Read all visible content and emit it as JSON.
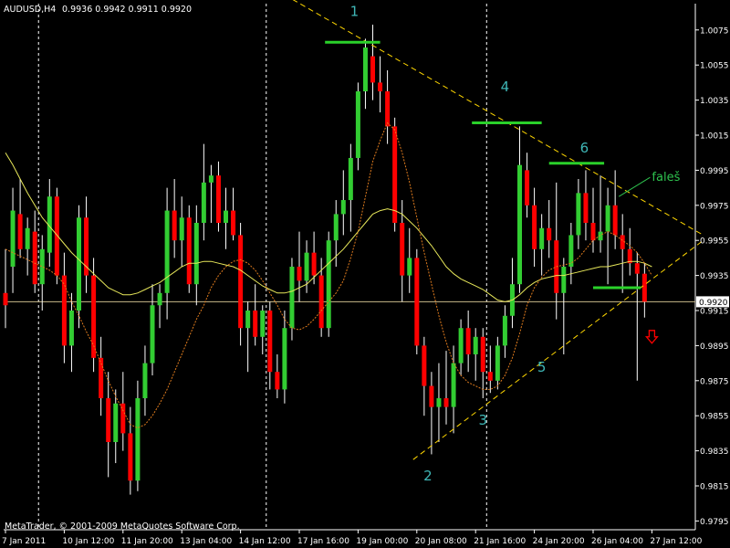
{
  "header": {
    "symbol": "AUDUSD,H4",
    "ohlc": "0.9936 0.9942 0.9911 0.9920"
  },
  "footer": {
    "copyright": "MetaTrader, © 2001-2009 MetaQuotes Software Corp."
  },
  "colors": {
    "background": "#000000",
    "bull_candle": "#32cd32",
    "bear_candle": "#ff0000",
    "wick": "#ffffff",
    "ma_slow": "#e8e85a",
    "ma_fast": "#e07c1e",
    "trendline": "#ffd700",
    "level_line": "#2ad12a",
    "wave_label": "#3fb7b7",
    "annotation": "#2ec24e",
    "arrow": "#ff0000",
    "price_line": "#c8b98a",
    "axis_text": "#ffffff"
  },
  "chart_data": {
    "type": "candlestick",
    "instrument": "AUDUSD",
    "timeframe": "H4",
    "ylim": [
      0.979,
      1.009
    ],
    "last_price": 0.992,
    "y_ticks": [
      "1.0075",
      "1.0055",
      "1.0035",
      "1.0015",
      "0.9995",
      "0.9975",
      "0.9955",
      "0.9935",
      "0.9915",
      "0.9895",
      "0.9875",
      "0.9855",
      "0.9835",
      "0.9815",
      "0.9795"
    ],
    "x_ticks": [
      "7 Jan 2011",
      "10 Jan 12:00",
      "11 Jan 20:00",
      "13 Jan 04:00",
      "14 Jan 12:00",
      "17 Jan 16:00",
      "19 Jan 00:00",
      "20 Jan 08:00",
      "21 Jan 16:00",
      "24 Jan 20:00",
      "26 Jan 04:00",
      "27 Jan 12:00"
    ],
    "x_tick_bars": [
      0,
      8,
      16,
      24,
      32,
      40,
      48,
      56,
      64,
      72,
      80,
      88
    ],
    "day_separators_bar": [
      4,
      35,
      65
    ],
    "candles": [
      {
        "o": 0.9925,
        "h": 0.995,
        "l": 0.9905,
        "c": 0.9918
      },
      {
        "o": 0.994,
        "h": 0.9985,
        "l": 0.9925,
        "c": 0.9972
      },
      {
        "o": 0.997,
        "h": 0.999,
        "l": 0.9945,
        "c": 0.995
      },
      {
        "o": 0.995,
        "h": 0.9968,
        "l": 0.9935,
        "c": 0.9962
      },
      {
        "o": 0.996,
        "h": 0.9972,
        "l": 0.9925,
        "c": 0.993
      },
      {
        "o": 0.993,
        "h": 0.9958,
        "l": 0.9915,
        "c": 0.995
      },
      {
        "o": 0.9948,
        "h": 0.999,
        "l": 0.994,
        "c": 0.998
      },
      {
        "o": 0.998,
        "h": 0.9985,
        "l": 0.993,
        "c": 0.9935
      },
      {
        "o": 0.9935,
        "h": 0.9948,
        "l": 0.9885,
        "c": 0.9895
      },
      {
        "o": 0.9895,
        "h": 0.9925,
        "l": 0.988,
        "c": 0.9915
      },
      {
        "o": 0.9915,
        "h": 0.9975,
        "l": 0.9905,
        "c": 0.9968
      },
      {
        "o": 0.9968,
        "h": 0.998,
        "l": 0.9925,
        "c": 0.9935
      },
      {
        "o": 0.9935,
        "h": 0.9945,
        "l": 0.988,
        "c": 0.9888
      },
      {
        "o": 0.9888,
        "h": 0.99,
        "l": 0.9855,
        "c": 0.9865
      },
      {
        "o": 0.9865,
        "h": 0.988,
        "l": 0.982,
        "c": 0.984
      },
      {
        "o": 0.984,
        "h": 0.987,
        "l": 0.9828,
        "c": 0.9862
      },
      {
        "o": 0.9862,
        "h": 0.988,
        "l": 0.9835,
        "c": 0.9845
      },
      {
        "o": 0.9845,
        "h": 0.986,
        "l": 0.981,
        "c": 0.9818
      },
      {
        "o": 0.9818,
        "h": 0.9875,
        "l": 0.9812,
        "c": 0.9865
      },
      {
        "o": 0.9865,
        "h": 0.9895,
        "l": 0.9855,
        "c": 0.9885
      },
      {
        "o": 0.9885,
        "h": 0.993,
        "l": 0.9878,
        "c": 0.9918
      },
      {
        "o": 0.9918,
        "h": 0.993,
        "l": 0.9905,
        "c": 0.9925
      },
      {
        "o": 0.9925,
        "h": 0.9985,
        "l": 0.991,
        "c": 0.9972
      },
      {
        "o": 0.9972,
        "h": 0.999,
        "l": 0.9945,
        "c": 0.9955
      },
      {
        "o": 0.9955,
        "h": 0.998,
        "l": 0.994,
        "c": 0.9968
      },
      {
        "o": 0.9968,
        "h": 0.9975,
        "l": 0.9925,
        "c": 0.993
      },
      {
        "o": 0.993,
        "h": 0.9975,
        "l": 0.9918,
        "c": 0.9965
      },
      {
        "o": 0.9965,
        "h": 1.001,
        "l": 0.9955,
        "c": 0.9988
      },
      {
        "o": 0.9988,
        "h": 0.9998,
        "l": 0.9965,
        "c": 0.9992
      },
      {
        "o": 0.9992,
        "h": 1.0,
        "l": 0.996,
        "c": 0.9965
      },
      {
        "o": 0.9965,
        "h": 0.9985,
        "l": 0.995,
        "c": 0.9972
      },
      {
        "o": 0.9972,
        "h": 0.9985,
        "l": 0.9955,
        "c": 0.9958
      },
      {
        "o": 0.9958,
        "h": 0.9965,
        "l": 0.9895,
        "c": 0.9905
      },
      {
        "o": 0.9905,
        "h": 0.992,
        "l": 0.988,
        "c": 0.9915
      },
      {
        "o": 0.9915,
        "h": 0.993,
        "l": 0.9895,
        "c": 0.99
      },
      {
        "o": 0.99,
        "h": 0.9918,
        "l": 0.989,
        "c": 0.9915
      },
      {
        "o": 0.9915,
        "h": 0.992,
        "l": 0.987,
        "c": 0.988
      },
      {
        "o": 0.988,
        "h": 0.989,
        "l": 0.9865,
        "c": 0.987
      },
      {
        "o": 0.987,
        "h": 0.9915,
        "l": 0.9862,
        "c": 0.9905
      },
      {
        "o": 0.9905,
        "h": 0.9945,
        "l": 0.9898,
        "c": 0.994
      },
      {
        "o": 0.994,
        "h": 0.996,
        "l": 0.992,
        "c": 0.9932
      },
      {
        "o": 0.9932,
        "h": 0.9955,
        "l": 0.9925,
        "c": 0.9948
      },
      {
        "o": 0.9948,
        "h": 0.996,
        "l": 0.993,
        "c": 0.9935
      },
      {
        "o": 0.9935,
        "h": 0.9945,
        "l": 0.99,
        "c": 0.9905
      },
      {
        "o": 0.9905,
        "h": 0.996,
        "l": 0.99,
        "c": 0.9955
      },
      {
        "o": 0.9955,
        "h": 0.9978,
        "l": 0.994,
        "c": 0.997
      },
      {
        "o": 0.997,
        "h": 0.9995,
        "l": 0.9958,
        "c": 0.9978
      },
      {
        "o": 0.9978,
        "h": 1.001,
        "l": 0.996,
        "c": 1.0002
      },
      {
        "o": 1.0002,
        "h": 1.0045,
        "l": 0.9995,
        "c": 1.004
      },
      {
        "o": 1.004,
        "h": 1.007,
        "l": 1.003,
        "c": 1.0065
      },
      {
        "o": 1.006,
        "h": 1.0078,
        "l": 1.0035,
        "c": 1.0045
      },
      {
        "o": 1.0045,
        "h": 1.006,
        "l": 1.0028,
        "c": 1.004
      },
      {
        "o": 1.004,
        "h": 1.0052,
        "l": 1.001,
        "c": 1.002
      },
      {
        "o": 1.002,
        "h": 1.0025,
        "l": 0.996,
        "c": 0.9965
      },
      {
        "o": 0.9965,
        "h": 0.9978,
        "l": 0.992,
        "c": 0.9935
      },
      {
        "o": 0.9935,
        "h": 0.9962,
        "l": 0.9925,
        "c": 0.9945
      },
      {
        "o": 0.9945,
        "h": 0.995,
        "l": 0.989,
        "c": 0.9895
      },
      {
        "o": 0.9895,
        "h": 0.99,
        "l": 0.9855,
        "c": 0.9872
      },
      {
        "o": 0.9872,
        "h": 0.988,
        "l": 0.9833,
        "c": 0.986
      },
      {
        "o": 0.986,
        "h": 0.9885,
        "l": 0.984,
        "c": 0.9865
      },
      {
        "o": 0.9865,
        "h": 0.9892,
        "l": 0.985,
        "c": 0.986
      },
      {
        "o": 0.986,
        "h": 0.9895,
        "l": 0.9845,
        "c": 0.9885
      },
      {
        "o": 0.9885,
        "h": 0.991,
        "l": 0.9878,
        "c": 0.9905
      },
      {
        "o": 0.9905,
        "h": 0.9915,
        "l": 0.988,
        "c": 0.989
      },
      {
        "o": 0.989,
        "h": 0.9905,
        "l": 0.9875,
        "c": 0.99
      },
      {
        "o": 0.99,
        "h": 0.9905,
        "l": 0.9865,
        "c": 0.988
      },
      {
        "o": 0.988,
        "h": 0.9895,
        "l": 0.9868,
        "c": 0.9875
      },
      {
        "o": 0.9875,
        "h": 0.99,
        "l": 0.987,
        "c": 0.9895
      },
      {
        "o": 0.9895,
        "h": 0.9918,
        "l": 0.9888,
        "c": 0.9912
      },
      {
        "o": 0.9912,
        "h": 0.9945,
        "l": 0.9905,
        "c": 0.993
      },
      {
        "o": 0.993,
        "h": 1.002,
        "l": 0.9925,
        "c": 0.9998
      },
      {
        "o": 0.9995,
        "h": 1.0005,
        "l": 0.9968,
        "c": 0.9975
      },
      {
        "o": 0.9975,
        "h": 0.9985,
        "l": 0.994,
        "c": 0.995
      },
      {
        "o": 0.995,
        "h": 0.997,
        "l": 0.9935,
        "c": 0.9962
      },
      {
        "o": 0.9962,
        "h": 0.9978,
        "l": 0.9945,
        "c": 0.9955
      },
      {
        "o": 0.9955,
        "h": 0.9988,
        "l": 0.991,
        "c": 0.9925
      },
      {
        "o": 0.9925,
        "h": 0.9945,
        "l": 0.989,
        "c": 0.994
      },
      {
        "o": 0.994,
        "h": 0.9965,
        "l": 0.993,
        "c": 0.9958
      },
      {
        "o": 0.9958,
        "h": 0.999,
        "l": 0.995,
        "c": 0.9982
      },
      {
        "o": 0.9982,
        "h": 0.9995,
        "l": 0.9955,
        "c": 0.9965
      },
      {
        "o": 0.9965,
        "h": 0.9985,
        "l": 0.9948,
        "c": 0.9955
      },
      {
        "o": 0.9955,
        "h": 0.9992,
        "l": 0.9948,
        "c": 0.996
      },
      {
        "o": 0.996,
        "h": 0.9985,
        "l": 0.993,
        "c": 0.9975
      },
      {
        "o": 0.9975,
        "h": 0.9995,
        "l": 0.995,
        "c": 0.9958
      },
      {
        "o": 0.9958,
        "h": 0.997,
        "l": 0.9925,
        "c": 0.995
      },
      {
        "o": 0.995,
        "h": 0.9962,
        "l": 0.9935,
        "c": 0.9942
      },
      {
        "o": 0.9942,
        "h": 0.9948,
        "l": 0.9875,
        "c": 0.9936
      },
      {
        "o": 0.9936,
        "h": 0.9942,
        "l": 0.9911,
        "c": 0.992
      }
    ],
    "ma_slow": [
      1.0005,
      0.9998,
      0.999,
      0.9982,
      0.9975,
      0.9968,
      0.9963,
      0.9958,
      0.9953,
      0.9948,
      0.9944,
      0.994,
      0.9936,
      0.9932,
      0.9928,
      0.9926,
      0.9924,
      0.9924,
      0.9925,
      0.9927,
      0.9929,
      0.9931,
      0.9934,
      0.9937,
      0.994,
      0.9942,
      0.9942,
      0.9943,
      0.9943,
      0.9942,
      0.9941,
      0.994,
      0.9938,
      0.9935,
      0.9932,
      0.9929,
      0.9927,
      0.9925,
      0.9925,
      0.9926,
      0.9928,
      0.993,
      0.9934,
      0.9938,
      0.9942,
      0.9946,
      0.995,
      0.9955,
      0.996,
      0.9965,
      0.997,
      0.9972,
      0.9973,
      0.9972,
      0.997,
      0.9966,
      0.9962,
      0.9957,
      0.9952,
      0.9946,
      0.994,
      0.9936,
      0.9933,
      0.9931,
      0.9929,
      0.9927,
      0.9924,
      0.9921,
      0.992,
      0.9921,
      0.9924,
      0.9928,
      0.9931,
      0.9933,
      0.9934,
      0.9935,
      0.9935,
      0.9936,
      0.9937,
      0.9938,
      0.9939,
      0.994,
      0.994,
      0.9941,
      0.9942,
      0.9943,
      0.9943,
      0.9942,
      0.994
    ],
    "ma_fast": [
      0.995,
      0.9948,
      0.9946,
      0.9944,
      0.9942,
      0.994,
      0.9938,
      0.9935,
      0.993,
      0.992,
      0.9912,
      0.9903,
      0.9895,
      0.9885,
      0.9875,
      0.9866,
      0.9858,
      0.985,
      0.9848,
      0.985,
      0.9855,
      0.9862,
      0.987,
      0.988,
      0.989,
      0.99,
      0.991,
      0.9918,
      0.9928,
      0.9935,
      0.994,
      0.9943,
      0.9944,
      0.9942,
      0.9938,
      0.9932,
      0.9925,
      0.9918,
      0.991,
      0.9905,
      0.9904,
      0.9906,
      0.991,
      0.9915,
      0.992,
      0.9925,
      0.9932,
      0.9945,
      0.996,
      0.998,
      1.0,
      1.0012,
      1.0022,
      1.0018,
      1.0005,
      0.9988,
      0.9968,
      0.9948,
      0.993,
      0.9912,
      0.9897,
      0.9885,
      0.9878,
      0.9874,
      0.9872,
      0.987,
      0.987,
      0.9872,
      0.9878,
      0.9888,
      0.9902,
      0.9918,
      0.9928,
      0.9934,
      0.9938,
      0.994,
      0.9941,
      0.9942,
      0.9945,
      0.995,
      0.9955,
      0.9958,
      0.996,
      0.9958,
      0.9955,
      0.9952,
      0.9948,
      0.9942,
      0.9935
    ],
    "annotations": {
      "wave_labels": [
        {
          "text": "1",
          "bar": 47.5,
          "price": 1.0083
        },
        {
          "text": "2",
          "bar": 57.5,
          "price": 0.9818
        },
        {
          "text": "3",
          "bar": 65.0,
          "price": 0.985
        },
        {
          "text": "4",
          "bar": 68.0,
          "price": 1.004
        },
        {
          "text": "5",
          "bar": 73.0,
          "price": 0.988
        },
        {
          "text": "6",
          "bar": 78.8,
          "price": 1.0005
        }
      ],
      "note": {
        "text": "faleš",
        "bar": 88.5,
        "price": 0.9992
      },
      "level_lines": [
        {
          "bar1": 43.5,
          "bar2": 51.0,
          "price": 1.0068
        },
        {
          "bar1": 63.5,
          "bar2": 73.0,
          "price": 1.0022
        },
        {
          "bar1": 74.0,
          "bar2": 81.5,
          "price": 0.9999
        },
        {
          "bar1": 80.0,
          "bar2": 86.5,
          "price": 0.9928
        }
      ],
      "trendlines": [
        {
          "bar1": 38.0,
          "p1": 1.0095,
          "bar2": 95.0,
          "p2": 0.9958
        },
        {
          "bar1": 55.5,
          "p1": 0.983,
          "bar2": 95.0,
          "p2": 0.9955
        }
      ],
      "arrow": {
        "bar": 88.0,
        "price": 0.99
      }
    }
  }
}
